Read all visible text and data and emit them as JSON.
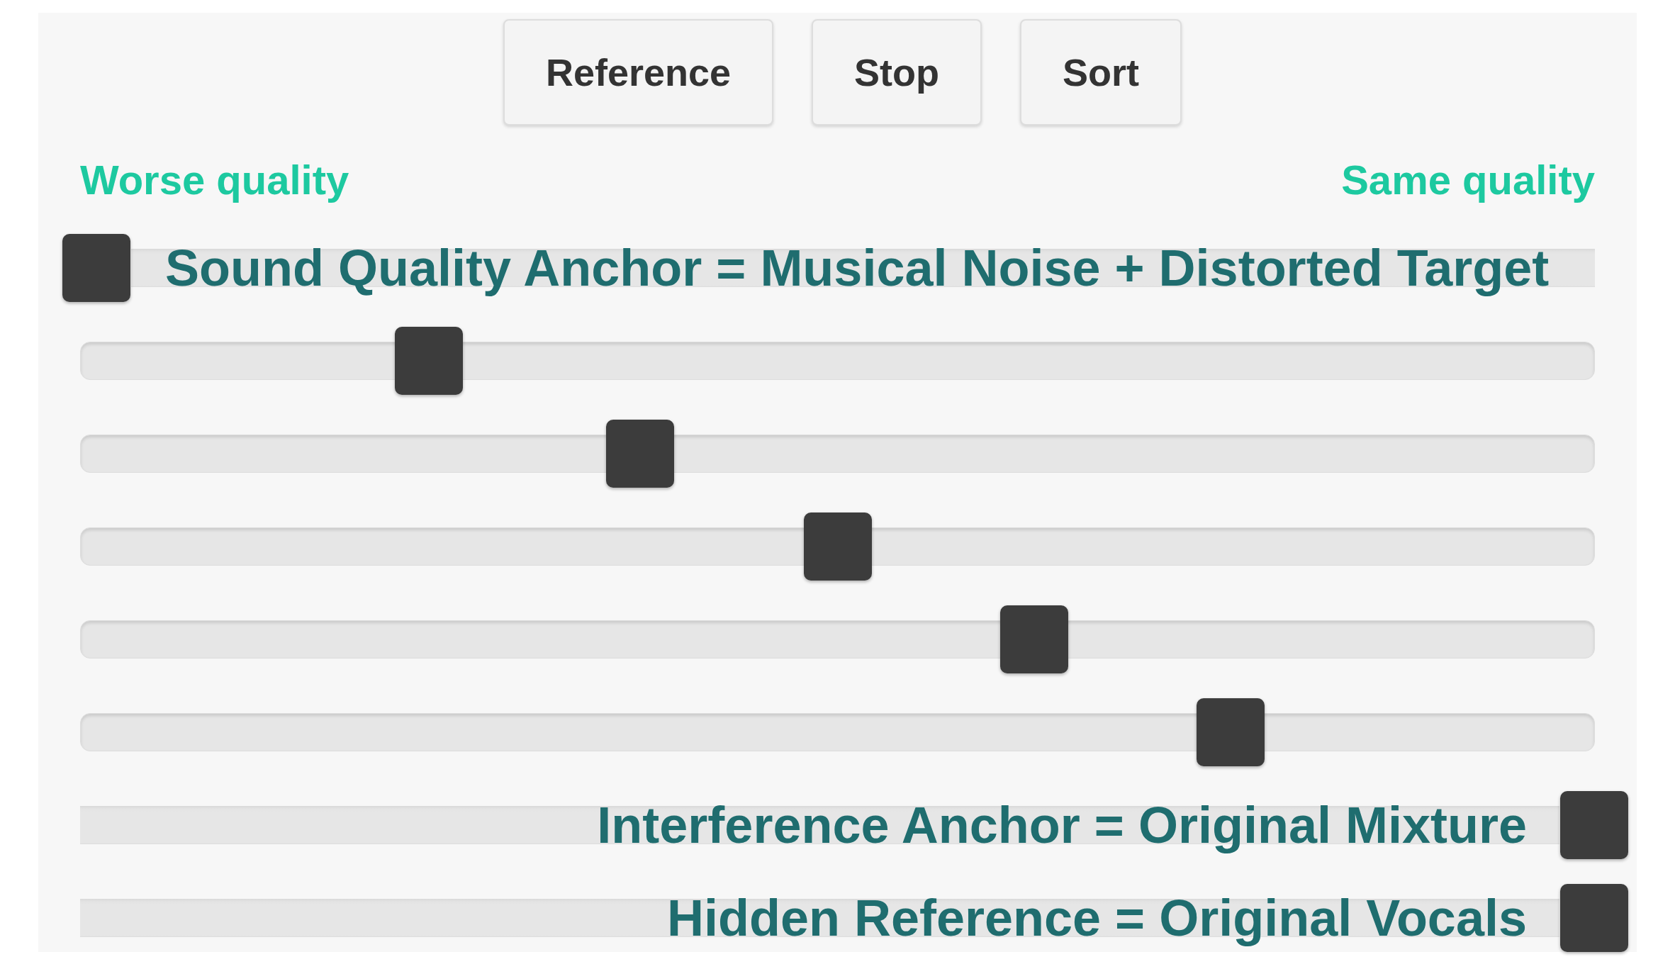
{
  "buttons": [
    {
      "label": "Reference"
    },
    {
      "label": "Stop"
    },
    {
      "label": "Sort"
    }
  ],
  "scale": {
    "left_label": "Worse quality",
    "right_label": "Same quality"
  },
  "sliders": [
    {
      "level": 0,
      "label": "Sound Quality Anchor = Musical Noise + Distorted Target",
      "kind": "start"
    },
    {
      "level": 0.222
    },
    {
      "level": 0.363
    },
    {
      "level": 0.495
    },
    {
      "level": 0.626
    },
    {
      "level": 0.757
    },
    {
      "level": 1,
      "label": "Interference Anchor = Original Mixture",
      "kind": "end"
    },
    {
      "level": 1,
      "label": "Hidden Reference = Original Vocals",
      "kind": "end"
    }
  ]
}
